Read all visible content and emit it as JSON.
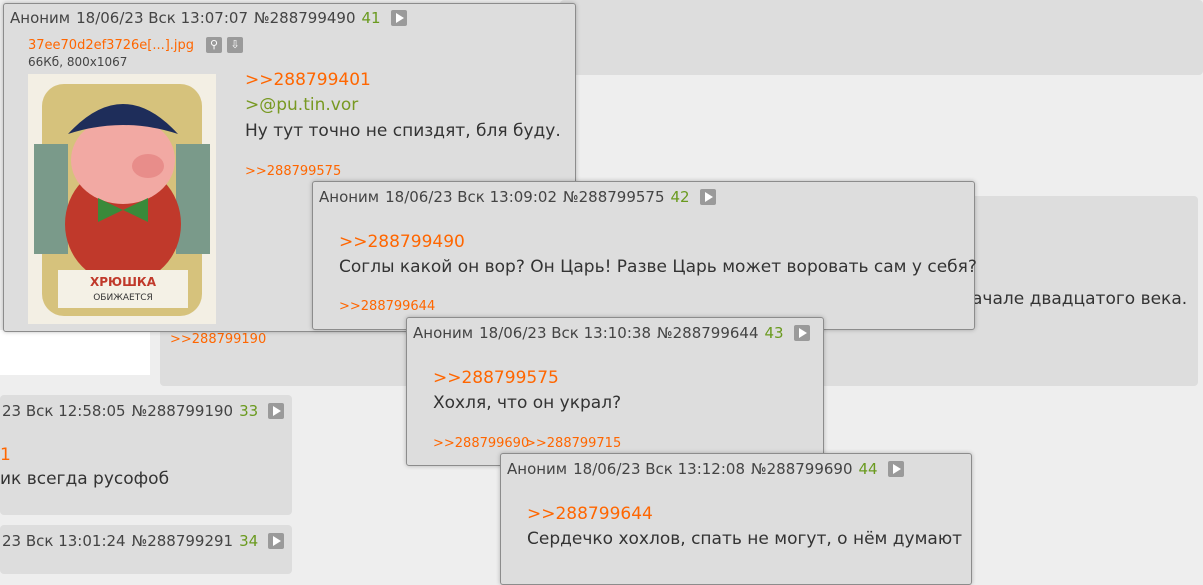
{
  "bg_posts": {
    "right_text": "ачале двадцатого века.",
    "reply_190": ">>288799190",
    "post33": {
      "date": "23 Вск 12:58:05",
      "no": "№288799190",
      "idx": "33",
      "quote_frag": "1",
      "text": "ик всегда русофоб"
    },
    "post34": {
      "date": "23 Вск 13:01:24",
      "no": "№288799291",
      "idx": "34"
    }
  },
  "popup1": {
    "name": "Аноним",
    "date": "18/06/23 Вск 13:07:07",
    "no": "№288799490",
    "idx": "41",
    "file": {
      "name": "37ee70d2ef3726e[...].jpg",
      "meta": "66Кб, 800x1067",
      "caption": "ХРЮШКА ОБИЖАЕТСЯ"
    },
    "quote": ">>288799401",
    "greentext": ">@pu.tin.vor",
    "text": "Ну тут точно не спиздят, бля буду.",
    "replies": ">>288799575"
  },
  "popup2": {
    "name": "Аноним",
    "date": "18/06/23 Вск 13:09:02",
    "no": "№288799575",
    "idx": "42",
    "quote": ">>288799490",
    "text": "Соглы какой он вор? Он Царь! Разве Царь может воровать сам у себя?",
    "replies": ">>288799644"
  },
  "popup3": {
    "name": "Аноним",
    "date": "18/06/23 Вск 13:10:38",
    "no": "№288799644",
    "idx": "43",
    "quote": ">>288799575",
    "text": "Хохля, что он украл?",
    "reply_a": ">>288799690",
    "reply_b": ">>288799715"
  },
  "popup4": {
    "name": "Аноним",
    "date": "18/06/23 Вск 13:12:08",
    "no": "№288799690",
    "idx": "44",
    "quote": ">>288799644",
    "text": "Сердечко хохлов, спать не могут, о нём думают"
  }
}
